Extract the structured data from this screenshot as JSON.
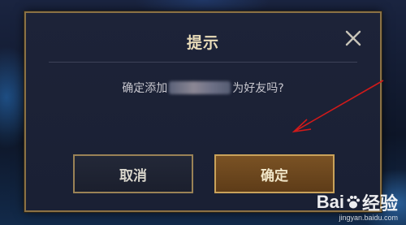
{
  "dialog": {
    "title": "提示",
    "message_prefix": "确定添加",
    "message_suffix": "为好友吗?",
    "cancel_label": "取消",
    "confirm_label": "确定",
    "close_icon": "close-icon"
  },
  "watermark": {
    "brand_left": "Bai",
    "brand_right": "经验",
    "url": "jingyan.baidu.com"
  },
  "colors": {
    "dialog_border": "#8a7145",
    "title_text": "#e9dcb9",
    "confirm_button": "#7a5224",
    "annotation_arrow": "#d11a1a"
  }
}
